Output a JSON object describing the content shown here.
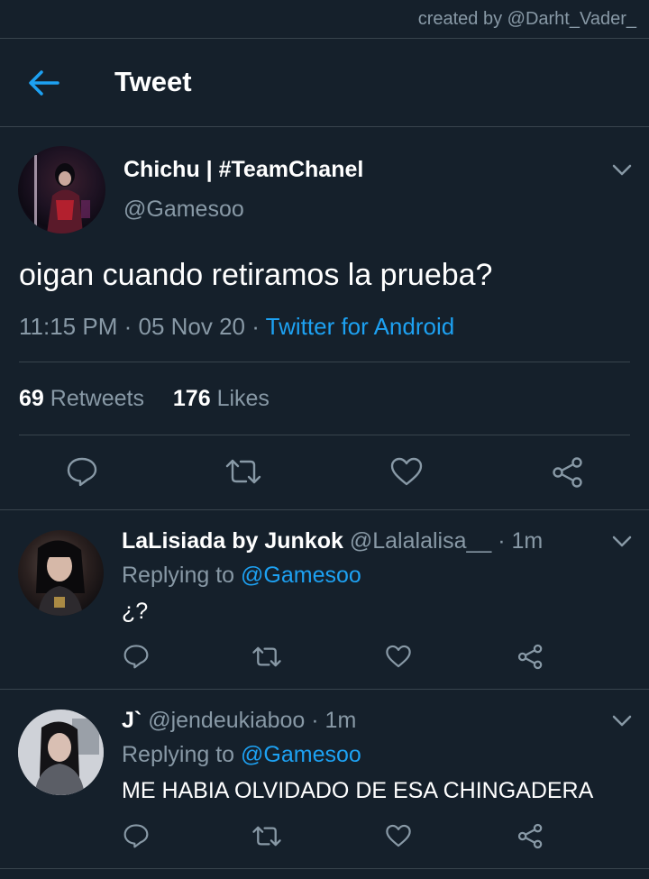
{
  "credit": "created by @Darht_Vader_",
  "header": {
    "title": "Tweet"
  },
  "main_tweet": {
    "display_name": "Chichu | #TeamChanel",
    "handle": "@Gamesoo",
    "text": "oigan cuando retiramos la prueba?",
    "time": "11:15 PM",
    "date": "05 Nov 20",
    "source": "Twitter for Android",
    "retweets_count": "69",
    "retweets_label": "Retweets",
    "likes_count": "176",
    "likes_label": "Likes"
  },
  "replies": [
    {
      "display_name": "LaLisiada by Junkok",
      "handle": "@Lalalalisa__",
      "time": "1m",
      "replying_label": "Replying to",
      "replying_to": "@Gamesoo",
      "text": "¿?"
    },
    {
      "display_name": "J`",
      "handle": "@jendeukiaboo",
      "time": "1m",
      "replying_label": "Replying to",
      "replying_to": "@Gamesoo",
      "text": "ME HABIA OLVIDADO DE ESA CHINGADERA"
    }
  ],
  "icons": {
    "back": "back-arrow-icon",
    "more": "chevron-down-icon",
    "reply": "reply-icon",
    "retweet": "retweet-icon",
    "like": "like-icon",
    "share": "share-icon"
  },
  "colors": {
    "background": "#15202b",
    "divider": "#38444d",
    "accent": "#1da1f2",
    "secondary_text": "#8899a6",
    "primary_text": "#ffffff"
  }
}
